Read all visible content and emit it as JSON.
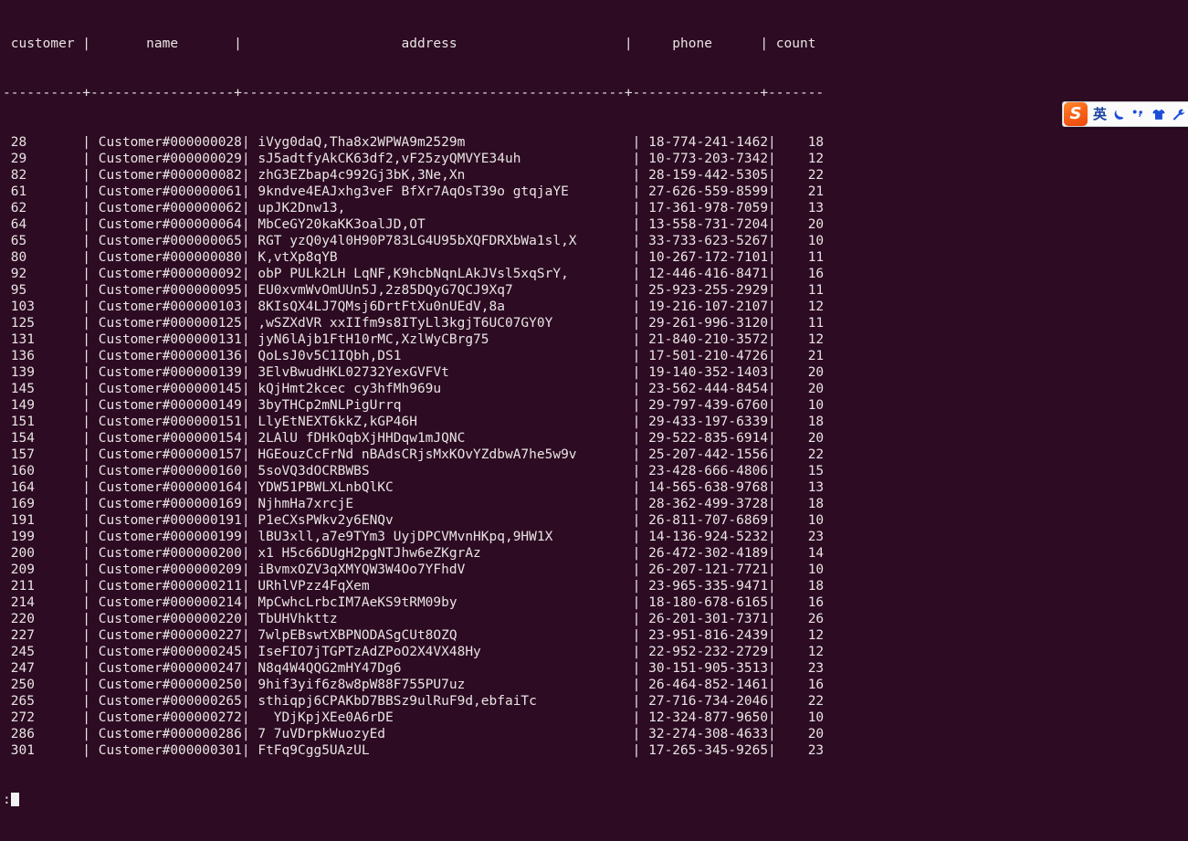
{
  "terminal": {
    "background_color": "#2d0b23",
    "foreground_color": "#e8e4e2",
    "prompt": ":",
    "cursor": "block"
  },
  "table": {
    "columns": [
      "customer",
      "name",
      "address",
      "phone",
      "count"
    ],
    "header_line": " customer |       name       |                    address                     |     phone      | count ",
    "separator_line": "----------+------------------+------------------------------------------------+----------------+-------",
    "rows": [
      {
        "customer": "28",
        "name": "Customer#000000028",
        "address": "iVyg0daQ,Tha8x2WPWA9m2529m",
        "phone": "18-774-241-1462",
        "count": "18"
      },
      {
        "customer": "29",
        "name": "Customer#000000029",
        "address": "sJ5adtfyAkCK63df2,vF25zyQMVYE34uh",
        "phone": "10-773-203-7342",
        "count": "12"
      },
      {
        "customer": "82",
        "name": "Customer#000000082",
        "address": "zhG3EZbap4c992Gj3bK,3Ne,Xn",
        "phone": "28-159-442-5305",
        "count": "22"
      },
      {
        "customer": "61",
        "name": "Customer#000000061",
        "address": "9kndve4EAJxhg3veF BfXr7AqOsT39o gtqjaYE",
        "phone": "27-626-559-8599",
        "count": "21"
      },
      {
        "customer": "62",
        "name": "Customer#000000062",
        "address": "upJK2Dnw13,",
        "phone": "17-361-978-7059",
        "count": "13"
      },
      {
        "customer": "64",
        "name": "Customer#000000064",
        "address": "MbCeGY20kaKK3oalJD,OT",
        "phone": "13-558-731-7204",
        "count": "20"
      },
      {
        "customer": "65",
        "name": "Customer#000000065",
        "address": "RGT yzQ0y4l0H90P783LG4U95bXQFDRXbWa1sl,X",
        "phone": "33-733-623-5267",
        "count": "10"
      },
      {
        "customer": "80",
        "name": "Customer#000000080",
        "address": "K,vtXp8qYB",
        "phone": "10-267-172-7101",
        "count": "11"
      },
      {
        "customer": "92",
        "name": "Customer#000000092",
        "address": "obP PULk2LH LqNF,K9hcbNqnLAkJVsl5xqSrY,",
        "phone": "12-446-416-8471",
        "count": "16"
      },
      {
        "customer": "95",
        "name": "Customer#000000095",
        "address": "EU0xvmWvOmUUn5J,2z85DQyG7QCJ9Xq7",
        "phone": "25-923-255-2929",
        "count": "11"
      },
      {
        "customer": "103",
        "name": "Customer#000000103",
        "address": "8KIsQX4LJ7QMsj6DrtFtXu0nUEdV,8a",
        "phone": "19-216-107-2107",
        "count": "12"
      },
      {
        "customer": "125",
        "name": "Customer#000000125",
        "address": ",wSZXdVR xxIIfm9s8ITyLl3kgjT6UC07GY0Y",
        "phone": "29-261-996-3120",
        "count": "11"
      },
      {
        "customer": "131",
        "name": "Customer#000000131",
        "address": "jyN6lAjb1FtH10rMC,XzlWyCBrg75",
        "phone": "21-840-210-3572",
        "count": "12"
      },
      {
        "customer": "136",
        "name": "Customer#000000136",
        "address": "QoLsJ0v5C1IQbh,DS1",
        "phone": "17-501-210-4726",
        "count": "21"
      },
      {
        "customer": "139",
        "name": "Customer#000000139",
        "address": "3ElvBwudHKL02732YexGVFVt",
        "phone": "19-140-352-1403",
        "count": "20"
      },
      {
        "customer": "145",
        "name": "Customer#000000145",
        "address": "kQjHmt2kcec cy3hfMh969u",
        "phone": "23-562-444-8454",
        "count": "20"
      },
      {
        "customer": "149",
        "name": "Customer#000000149",
        "address": "3byTHCp2mNLPigUrrq",
        "phone": "29-797-439-6760",
        "count": "10"
      },
      {
        "customer": "151",
        "name": "Customer#000000151",
        "address": "LlyEtNEXT6kkZ,kGP46H",
        "phone": "29-433-197-6339",
        "count": "18"
      },
      {
        "customer": "154",
        "name": "Customer#000000154",
        "address": "2LAlU fDHkOqbXjHHDqw1mJQNC",
        "phone": "29-522-835-6914",
        "count": "20"
      },
      {
        "customer": "157",
        "name": "Customer#000000157",
        "address": "HGEouzCcFrNd nBAdsCRjsMxKOvYZdbwA7he5w9v",
        "phone": "25-207-442-1556",
        "count": "22"
      },
      {
        "customer": "160",
        "name": "Customer#000000160",
        "address": "5soVQ3dOCRBWBS",
        "phone": "23-428-666-4806",
        "count": "15"
      },
      {
        "customer": "164",
        "name": "Customer#000000164",
        "address": "YDW51PBWLXLnbQlKC",
        "phone": "14-565-638-9768",
        "count": "13"
      },
      {
        "customer": "169",
        "name": "Customer#000000169",
        "address": "NjhmHa7xrcjE",
        "phone": "28-362-499-3728",
        "count": "18"
      },
      {
        "customer": "191",
        "name": "Customer#000000191",
        "address": "P1eCXsPWkv2y6ENQv",
        "phone": "26-811-707-6869",
        "count": "10"
      },
      {
        "customer": "199",
        "name": "Customer#000000199",
        "address": "lBU3xll,a7e9TYm3 UyjDPCVMvnHKpq,9HW1X",
        "phone": "14-136-924-5232",
        "count": "23"
      },
      {
        "customer": "200",
        "name": "Customer#000000200",
        "address": "x1 H5c66DUgH2pgNTJhw6eZKgrAz",
        "phone": "26-472-302-4189",
        "count": "14"
      },
      {
        "customer": "209",
        "name": "Customer#000000209",
        "address": "iBvmxOZV3qXMYQW3W4Oo7YFhdV",
        "phone": "26-207-121-7721",
        "count": "10"
      },
      {
        "customer": "211",
        "name": "Customer#000000211",
        "address": "URhlVPzz4FqXem",
        "phone": "23-965-335-9471",
        "count": "18"
      },
      {
        "customer": "214",
        "name": "Customer#000000214",
        "address": "MpCwhcLrbcIM7AeKS9tRM09by",
        "phone": "18-180-678-6165",
        "count": "16"
      },
      {
        "customer": "220",
        "name": "Customer#000000220",
        "address": "TbUHVhkttz",
        "phone": "26-201-301-7371",
        "count": "26"
      },
      {
        "customer": "227",
        "name": "Customer#000000227",
        "address": "7wlpEBswtXBPNODASgCUt8OZQ",
        "phone": "23-951-816-2439",
        "count": "12"
      },
      {
        "customer": "245",
        "name": "Customer#000000245",
        "address": "IseFIO7jTGPTzAdZPoO2X4VX48Hy",
        "phone": "22-952-232-2729",
        "count": "12"
      },
      {
        "customer": "247",
        "name": "Customer#000000247",
        "address": "N8q4W4QQG2mHY47Dg6",
        "phone": "30-151-905-3513",
        "count": "23"
      },
      {
        "customer": "250",
        "name": "Customer#000000250",
        "address": "9hif3yif6z8w8pW88F755PU7uz",
        "phone": "26-464-852-1461",
        "count": "16"
      },
      {
        "customer": "265",
        "name": "Customer#000000265",
        "address": "sthiqpj6CPAKbD7BBSz9ulRuF9d,ebfaiTc",
        "phone": "27-716-734-2046",
        "count": "22"
      },
      {
        "customer": "272",
        "name": "Customer#000000272",
        "address": "  YDjKpjXEe0A6rDE",
        "phone": "12-324-877-9650",
        "count": "10"
      },
      {
        "customer": "286",
        "name": "Customer#000000286",
        "address": "7 7uVDrpkWuozyEd",
        "phone": "32-274-308-4633",
        "count": "20"
      },
      {
        "customer": "301",
        "name": "Customer#000000301",
        "address": "FtFq9Cgg5UAzUL",
        "phone": "17-265-345-9265",
        "count": "23"
      }
    ]
  },
  "ime_toolbar": {
    "logo_text": "S",
    "items": [
      {
        "name": "language-mode",
        "label": "英"
      },
      {
        "name": "moon-icon",
        "label": ""
      },
      {
        "name": "punctuation-icon",
        "label": ""
      },
      {
        "name": "skin-icon",
        "label": ""
      },
      {
        "name": "toolbox-icon",
        "label": ""
      }
    ],
    "accent_color": "#f8631a",
    "icon_color": "#1b4fd8"
  }
}
